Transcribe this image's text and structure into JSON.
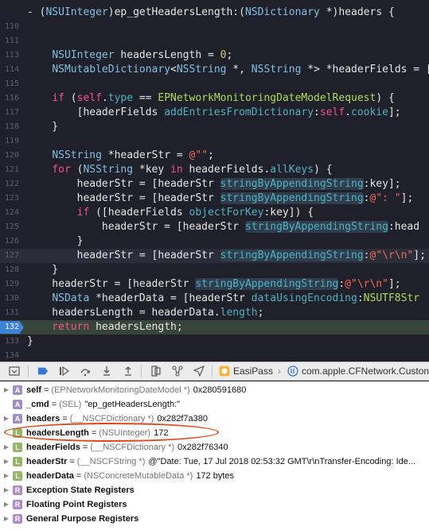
{
  "editor": {
    "lines": [
      {
        "num": "",
        "kind": "normal",
        "tokens": [
          {
            "t": "- (",
            "c": "txt"
          },
          {
            "t": "NSUInteger",
            "c": "type"
          },
          {
            "t": ")ep_getHeadersLength:(",
            "c": "txt"
          },
          {
            "t": "NSDictionary",
            "c": "type"
          },
          {
            "t": " *)headers {",
            "c": "txt"
          }
        ]
      },
      {
        "num": "110",
        "kind": "normal",
        "tokens": []
      },
      {
        "num": "111",
        "kind": "normal",
        "tokens": []
      },
      {
        "num": "113",
        "kind": "normal",
        "tokens": [
          {
            "t": "    ",
            "c": "txt"
          },
          {
            "t": "NSUInteger",
            "c": "type"
          },
          {
            "t": " headersLength = ",
            "c": "txt"
          },
          {
            "t": "0",
            "c": "num"
          },
          {
            "t": ";",
            "c": "txt"
          }
        ]
      },
      {
        "num": "114",
        "kind": "normal",
        "tokens": [
          {
            "t": "    ",
            "c": "txt"
          },
          {
            "t": "NSMutableDictionary",
            "c": "type"
          },
          {
            "t": "<",
            "c": "txt"
          },
          {
            "t": "NSString",
            "c": "type"
          },
          {
            "t": " *, ",
            "c": "txt"
          },
          {
            "t": "NSString",
            "c": "type"
          },
          {
            "t": " *> *headerFields = [",
            "c": "txt"
          }
        ]
      },
      {
        "num": "115",
        "kind": "normal",
        "tokens": []
      },
      {
        "num": "116",
        "kind": "normal",
        "tokens": [
          {
            "t": "    ",
            "c": "txt"
          },
          {
            "t": "if",
            "c": "kw"
          },
          {
            "t": " (",
            "c": "txt"
          },
          {
            "t": "self",
            "c": "kw"
          },
          {
            "t": ".",
            "c": "txt"
          },
          {
            "t": "type",
            "c": "fn"
          },
          {
            "t": " == ",
            "c": "txt"
          },
          {
            "t": "EPNetworkMonitoringDateModelRequest",
            "c": "cls"
          },
          {
            "t": ") {",
            "c": "txt"
          }
        ]
      },
      {
        "num": "117",
        "kind": "normal",
        "tokens": [
          {
            "t": "        [headerFields ",
            "c": "txt"
          },
          {
            "t": "addEntriesFromDictionary",
            "c": "fn"
          },
          {
            "t": ":",
            "c": "txt"
          },
          {
            "t": "self",
            "c": "kw"
          },
          {
            "t": ".",
            "c": "txt"
          },
          {
            "t": "cookie",
            "c": "fn"
          },
          {
            "t": "];",
            "c": "txt"
          }
        ]
      },
      {
        "num": "118",
        "kind": "normal",
        "tokens": [
          {
            "t": "    }",
            "c": "txt"
          }
        ]
      },
      {
        "num": "119",
        "kind": "normal",
        "tokens": []
      },
      {
        "num": "120",
        "kind": "normal",
        "tokens": [
          {
            "t": "    ",
            "c": "txt"
          },
          {
            "t": "NSString",
            "c": "type"
          },
          {
            "t": " *headerStr = ",
            "c": "txt"
          },
          {
            "t": "@\"\"",
            "c": "str"
          },
          {
            "t": ";",
            "c": "txt"
          }
        ]
      },
      {
        "num": "121",
        "kind": "normal",
        "tokens": [
          {
            "t": "    ",
            "c": "txt"
          },
          {
            "t": "for",
            "c": "kw"
          },
          {
            "t": " (",
            "c": "txt"
          },
          {
            "t": "NSString",
            "c": "type"
          },
          {
            "t": " *key ",
            "c": "txt"
          },
          {
            "t": "in",
            "c": "kw"
          },
          {
            "t": " headerFields.",
            "c": "txt"
          },
          {
            "t": "allKeys",
            "c": "fn"
          },
          {
            "t": ") {",
            "c": "txt"
          }
        ]
      },
      {
        "num": "122",
        "kind": "normal",
        "tokens": [
          {
            "t": "        headerStr = [headerStr ",
            "c": "txt"
          },
          {
            "t": "stringByAppendingString",
            "c": "hl"
          },
          {
            "t": ":key];",
            "c": "txt"
          }
        ]
      },
      {
        "num": "123",
        "kind": "normal",
        "tokens": [
          {
            "t": "        headerStr = [headerStr ",
            "c": "txt"
          },
          {
            "t": "stringByAppendingString",
            "c": "hl"
          },
          {
            "t": ":",
            "c": "txt"
          },
          {
            "t": "@\": \"",
            "c": "str"
          },
          {
            "t": "];",
            "c": "txt"
          }
        ]
      },
      {
        "num": "124",
        "kind": "normal",
        "tokens": [
          {
            "t": "        ",
            "c": "txt"
          },
          {
            "t": "if",
            "c": "kw"
          },
          {
            "t": " ([headerFields ",
            "c": "txt"
          },
          {
            "t": "objectForKey",
            "c": "fn"
          },
          {
            "t": ":key]) {",
            "c": "txt"
          }
        ]
      },
      {
        "num": "125",
        "kind": "normal",
        "tokens": [
          {
            "t": "            headerStr = [headerStr ",
            "c": "txt"
          },
          {
            "t": "stringByAppendingString",
            "c": "hl"
          },
          {
            "t": ":head",
            "c": "txt"
          }
        ]
      },
      {
        "num": "126",
        "kind": "normal",
        "tokens": [
          {
            "t": "        }",
            "c": "txt"
          }
        ]
      },
      {
        "num": "127",
        "kind": "current",
        "tokens": [
          {
            "t": "        headerStr = [headerStr ",
            "c": "txt"
          },
          {
            "t": "stringByAppendingString",
            "c": "hl"
          },
          {
            "t": ":",
            "c": "txt"
          },
          {
            "t": "@\"\\r\\n\"",
            "c": "str"
          },
          {
            "t": "];",
            "c": "txt"
          }
        ]
      },
      {
        "num": "128",
        "kind": "normal",
        "tokens": [
          {
            "t": "    }",
            "c": "txt"
          }
        ]
      },
      {
        "num": "129",
        "kind": "normal",
        "tokens": [
          {
            "t": "    headerStr = [headerStr ",
            "c": "txt"
          },
          {
            "t": "stringByAppendingString",
            "c": "hl"
          },
          {
            "t": ":",
            "c": "txt"
          },
          {
            "t": "@\"\\r\\n\"",
            "c": "str"
          },
          {
            "t": "];",
            "c": "txt"
          }
        ]
      },
      {
        "num": "130",
        "kind": "normal",
        "tokens": [
          {
            "t": "    ",
            "c": "txt"
          },
          {
            "t": "NSData",
            "c": "type"
          },
          {
            "t": " *headerData = [headerStr ",
            "c": "txt"
          },
          {
            "t": "dataUsingEncoding",
            "c": "fn"
          },
          {
            "t": ":",
            "c": "txt"
          },
          {
            "t": "NSUTF8Str",
            "c": "cls"
          }
        ]
      },
      {
        "num": "131",
        "kind": "normal",
        "tokens": [
          {
            "t": "    headersLength = headerData.",
            "c": "txt"
          },
          {
            "t": "length",
            "c": "fn"
          },
          {
            "t": ";",
            "c": "txt"
          }
        ]
      },
      {
        "num": "132",
        "kind": "exec",
        "tokens": [
          {
            "t": "    ",
            "c": "txt"
          },
          {
            "t": "return",
            "c": "kw"
          },
          {
            "t": " headersLength;",
            "c": "txt"
          }
        ]
      },
      {
        "num": "133",
        "kind": "normal",
        "tokens": [
          {
            "t": "}",
            "c": "txt"
          }
        ]
      },
      {
        "num": "134",
        "kind": "normal",
        "tokens": []
      }
    ]
  },
  "toolbar": {
    "thread_label": "EasiPass",
    "frame_label": "com.apple.CFNetwork.Custon"
  },
  "variables": {
    "rows": [
      {
        "badge": "A",
        "name": "self",
        "type": "(EPNetworkMonitoringDateModel *)",
        "value": "0x280591680",
        "expandable": true
      },
      {
        "badge": "A",
        "name": "_cmd",
        "type": "(SEL)",
        "value": "\"ep_getHeadersLength:\"",
        "expandable": false
      },
      {
        "badge": "A",
        "name": "headers",
        "type": "(__NSCFDictionary *)",
        "value": "0x282f7a380",
        "expandable": true
      },
      {
        "badge": "L",
        "name": "headersLength",
        "type": "(NSUInteger)",
        "value": "172",
        "expandable": false
      },
      {
        "badge": "L",
        "name": "headerFields",
        "type": "(__NSCFDictionary *)",
        "value": "0x282f76340",
        "expandable": true
      },
      {
        "badge": "L",
        "name": "headerStr",
        "type": "(__NSCFString *)",
        "value": "@\"Date: Tue, 17 Jul 2018 02:53:32 GMT\\r\\nTransfer-Encoding: Ide...",
        "expandable": true
      },
      {
        "badge": "L",
        "name": "headerData",
        "type": "(NSConcreteMutableData *)",
        "value": "172 bytes",
        "expandable": true
      },
      {
        "badge": "R",
        "name": "Exception State Registers",
        "type": "",
        "value": "",
        "expandable": true,
        "section": true
      },
      {
        "badge": "R",
        "name": "Floating Point Registers",
        "type": "",
        "value": "",
        "expandable": true,
        "section": true
      },
      {
        "badge": "R",
        "name": "General Purpose Registers",
        "type": "",
        "value": "",
        "expandable": true,
        "section": true
      }
    ]
  }
}
